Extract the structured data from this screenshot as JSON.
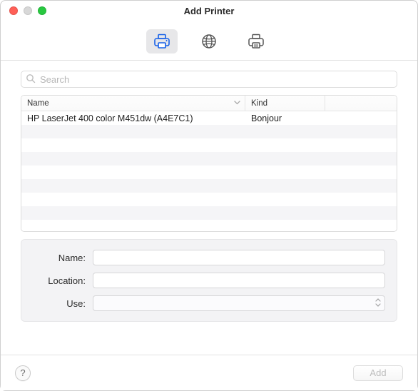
{
  "window": {
    "title": "Add Printer"
  },
  "toolbar": {
    "tabs": [
      {
        "id": "default",
        "name": "printer-default-icon",
        "active": true
      },
      {
        "id": "ip",
        "name": "globe-icon",
        "active": false
      },
      {
        "id": "windows",
        "name": "printer-advanced-icon",
        "active": false
      }
    ]
  },
  "search": {
    "placeholder": "Search",
    "value": ""
  },
  "table": {
    "columns": {
      "name": "Name",
      "kind": "Kind"
    },
    "sort_column": "name",
    "sort_dir": "asc",
    "rows": [
      {
        "name": "HP LaserJet 400 color M451dw (A4E7C1)",
        "kind": "Bonjour"
      }
    ],
    "visible_row_slots": 9
  },
  "form": {
    "name_label": "Name:",
    "name_value": "",
    "location_label": "Location:",
    "location_value": "",
    "use_label": "Use:",
    "use_value": ""
  },
  "footer": {
    "help_label": "?",
    "add_label": "Add",
    "add_enabled": false
  },
  "colors": {
    "accent": "#0a66ff",
    "toolbar_active_bg": "#e7e7e9",
    "panel_bg": "#f3f3f5"
  }
}
